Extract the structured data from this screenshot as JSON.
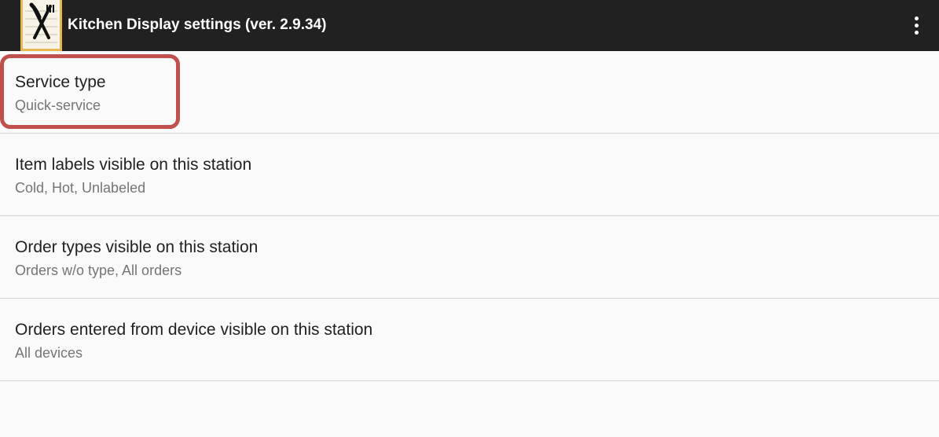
{
  "appbar": {
    "title": "Kitchen Display settings (ver. 2.9.34)",
    "icon": "kitchen-notepad-utensils-icon",
    "overflow_icon": "more-vert-icon",
    "background": "#212121"
  },
  "preferences": [
    {
      "title": "Service type",
      "summary": "Quick-service"
    },
    {
      "title": "Item labels visible on this station",
      "summary": "Cold, Hot, Unlabeled"
    },
    {
      "title": "Order types visible on this station",
      "summary": "Orders w/o type, All orders"
    },
    {
      "title": "Orders entered from device visible on this station",
      "summary": "All devices"
    }
  ],
  "highlight": {
    "target": "Service type",
    "color": "#c0504d"
  }
}
